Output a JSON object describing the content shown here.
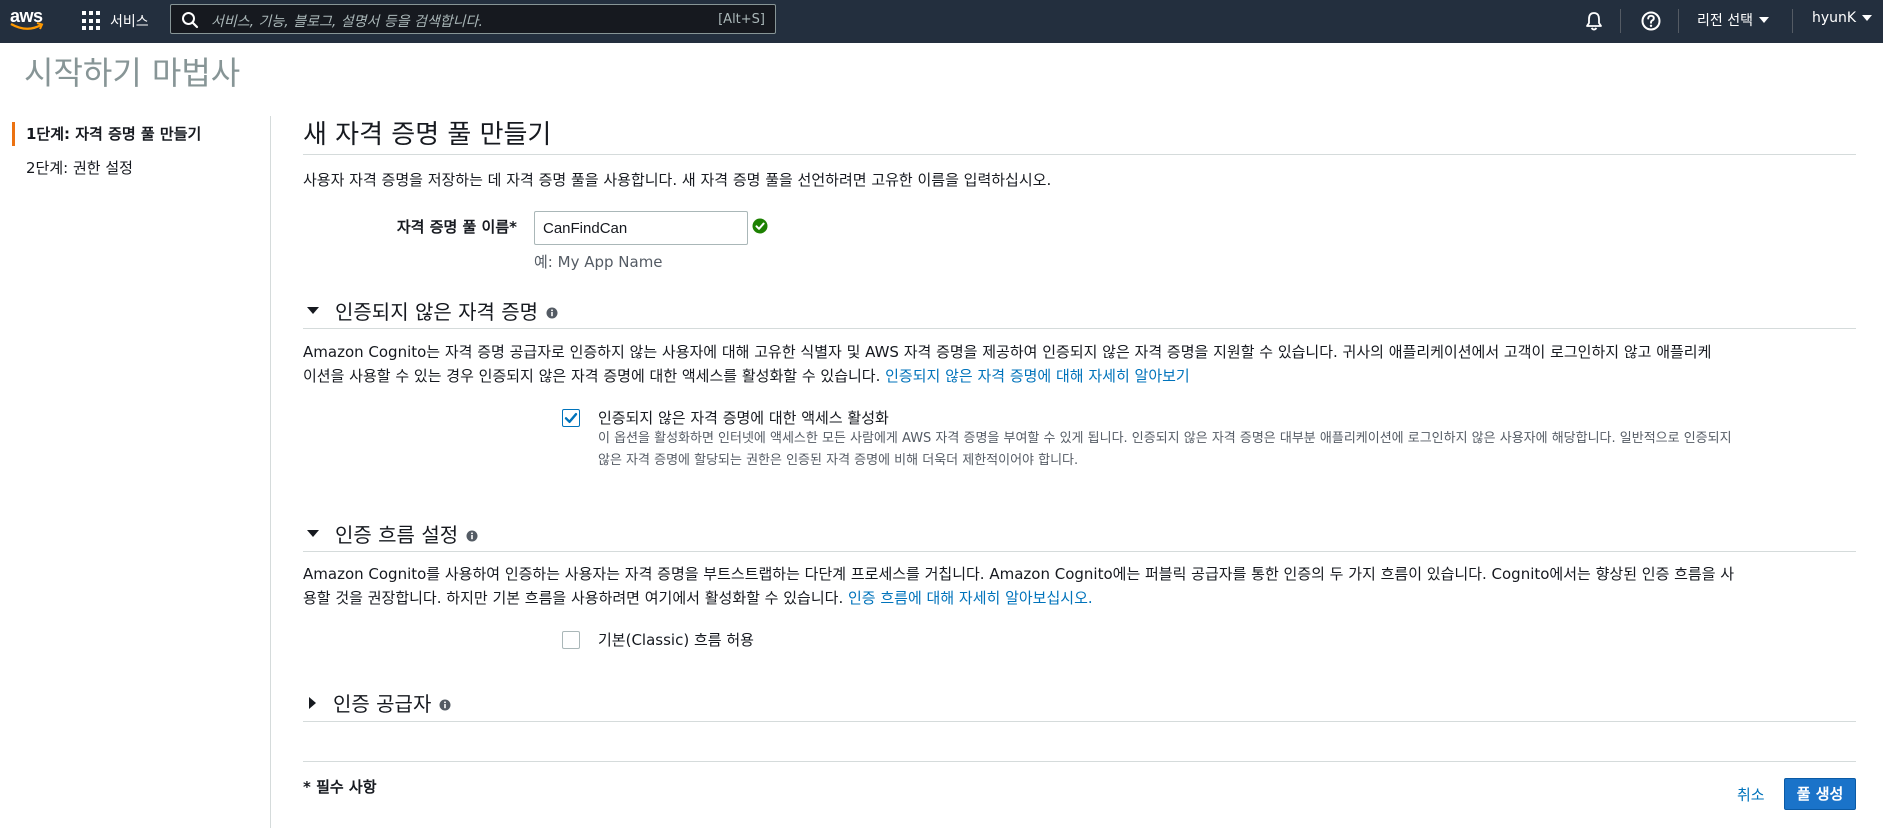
{
  "topnav": {
    "logo_text": "aws",
    "services_label": "서비스",
    "search_placeholder": "서비스, 기능, 블로그, 설명서 등을 검색합니다.",
    "search_shortcut": "[Alt+S]",
    "region_label": "리전 선택",
    "user_label": "hyunK",
    "icons": [
      "grid-icon",
      "search-icon",
      "bell-icon",
      "help-icon"
    ]
  },
  "page_title": "시작하기 마법사",
  "sidenav": {
    "steps": [
      {
        "label": "1단계: 자격 증명 풀 만들기",
        "active": true
      },
      {
        "label": "2단계: 권한 설정",
        "active": false
      }
    ]
  },
  "main": {
    "title": "새 자격 증명 풀 만들기",
    "intro": "사용자 자격 증명을 저장하는 데 자격 증명 풀을 사용합니다. 새 자격 증명 풀을 선언하려면 고유한 이름을 입력하십시오.",
    "pool_name": {
      "label": "자격 증명 풀 이름*",
      "value": "CanFindCan",
      "hint": "예: My App Name"
    },
    "unauth_section": {
      "title": "인증되지 않은 자격 증명",
      "desc_line1": "Amazon Cognito는 자격 증명 공급자로 인증하지 않는 사용자에 대해 고유한 식별자 및 AWS 자격 증명을 제공하여 인증되지 않은 자격 증명을 지원할 수 있습니다. 귀사의 애플리케이션에서 고객이 로그인하지 않고 애플리케",
      "desc_line2": "이션을 사용할 수 있는 경우 인증되지 않은 자격 증명에 대한 액세스를 활성화할 수 있습니다. ",
      "link": "인증되지 않은 자격 증명에 대해 자세히 알아보기",
      "checkbox_label": "인증되지 않은 자격 증명에 대한 액세스 활성화",
      "checkbox_checked": true,
      "checkbox_desc_line1": "이 옵션을 활성화하면 인터넷에 액세스한 모든 사람에게 AWS 자격 증명을 부여할 수 있게 됩니다. 인증되지 않은 자격 증명은 대부분 애플리케이션에 로그인하지 않은 사용자에 해당합니다. 일반적으로 인증되지",
      "checkbox_desc_line2": "않은 자격 증명에 할당되는 권한은 인증된 자격 증명에 비해 더욱더 제한적이어야 합니다."
    },
    "flow_section": {
      "title": "인증 흐름 설정",
      "desc_line1": "Amazon Cognito를 사용하여 인증하는 사용자는 자격 증명을 부트스트랩하는 다단계 프로세스를 거칩니다. Amazon Cognito에는 퍼블릭 공급자를 통한 인증의 두 가지 흐름이 있습니다. Cognito에서는 향상된 인증 흐름을 사",
      "desc_line2": "용할 것을 권장합니다. 하지만 기본 흐름을 사용하려면 여기에서 활성화할 수 있습니다. ",
      "link": "인증 흐름에 대해 자세히 알아보십시오.",
      "checkbox_label": "기본(Classic) 흐름 허용",
      "checkbox_checked": false
    },
    "provider_section": {
      "title": "인증 공급자"
    },
    "required_note": "* 필수 사항",
    "cancel_label": "취소",
    "create_label": "풀 생성"
  },
  "colors": {
    "nav_bg": "#232f3e",
    "link": "#0073bb",
    "primary_button": "#1a73c9",
    "active_step_bar": "#ec7211",
    "valid_green": "#1d8102"
  }
}
